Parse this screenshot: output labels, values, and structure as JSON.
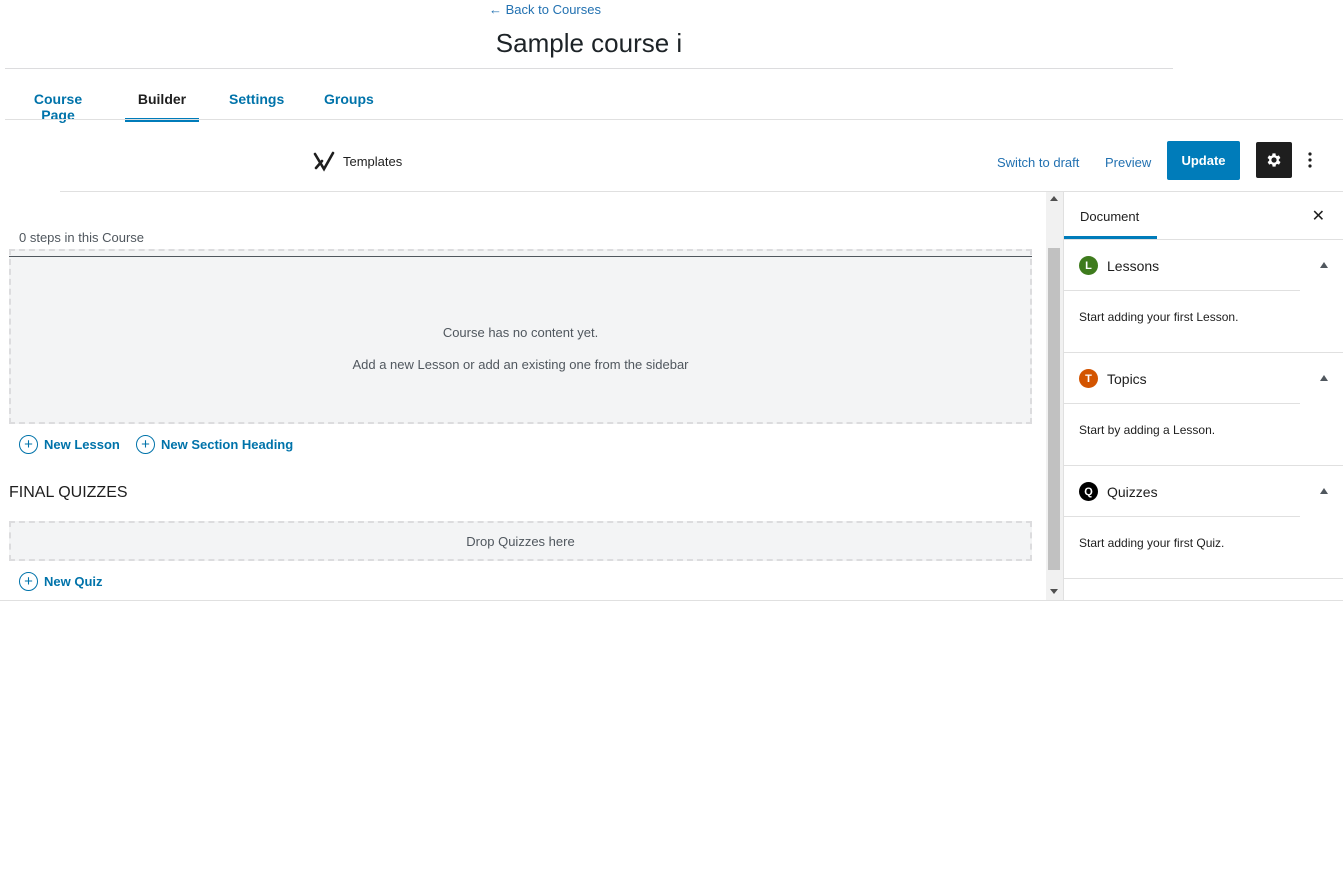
{
  "header": {
    "back_link": "← Back to Courses",
    "title": "Sample course i"
  },
  "tabs": [
    {
      "label": "Course Page",
      "active": false
    },
    {
      "label": "Builder",
      "active": true
    },
    {
      "label": "Settings",
      "active": false
    },
    {
      "label": "Groups",
      "active": false
    }
  ],
  "toolbar": {
    "templates_label": "Templates",
    "switch_draft_label": "Switch to draft",
    "preview_label": "Preview",
    "update_label": "Update"
  },
  "builder": {
    "steps_count": "0 steps in this Course",
    "empty_line1": "Course has no content yet.",
    "empty_line2": "Add a new Lesson or add an existing one from the sidebar",
    "new_lesson_label": "New Lesson",
    "new_section_heading_label": "New Section Heading",
    "final_quizzes_heading": "FINAL QUIZZES",
    "drop_quizzes_label": "Drop Quizzes here",
    "new_quiz_label": "New Quiz"
  },
  "sidebar": {
    "document_tab": "Document",
    "panels": [
      {
        "badge": "L",
        "badge_color": "#3e7b1d",
        "title": "Lessons",
        "body": "Start adding your first Lesson."
      },
      {
        "badge": "T",
        "badge_color": "#d35400",
        "title": "Topics",
        "body": "Start by adding a Lesson."
      },
      {
        "badge": "Q",
        "badge_color": "#000000",
        "title": "Quizzes",
        "body": "Start adding your first Quiz."
      }
    ]
  },
  "colors": {
    "accent": "#007cba",
    "link": "#0073aa"
  }
}
